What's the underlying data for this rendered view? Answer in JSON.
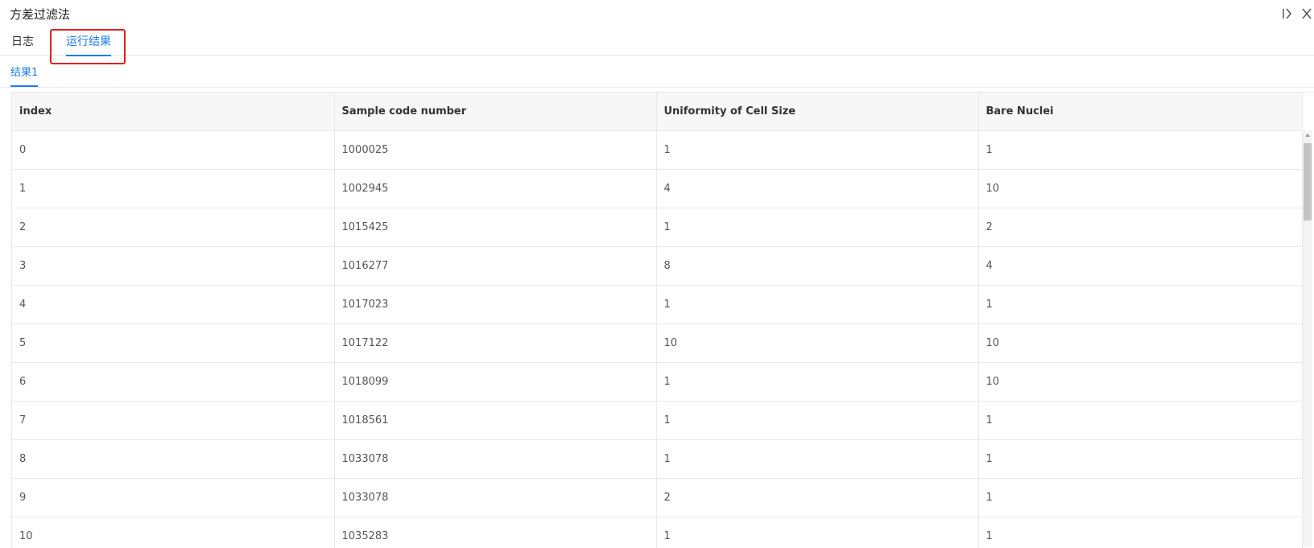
{
  "window": {
    "title": "方差过滤法",
    "controls": {
      "expand_icon": "collapse-panel-icon",
      "close_icon": "close-icon"
    }
  },
  "tabs": [
    {
      "label": "日志",
      "active": false
    },
    {
      "label": "运行结果",
      "active": true
    }
  ],
  "subtabs": [
    {
      "label": "结果1",
      "active": true
    }
  ],
  "table": {
    "columns": [
      "index",
      "Sample code number",
      "Uniformity of Cell Size",
      "Bare Nuclei"
    ],
    "rows": [
      [
        "0",
        "1000025",
        "1",
        "1"
      ],
      [
        "1",
        "1002945",
        "4",
        "10"
      ],
      [
        "2",
        "1015425",
        "1",
        "2"
      ],
      [
        "3",
        "1016277",
        "8",
        "4"
      ],
      [
        "4",
        "1017023",
        "1",
        "1"
      ],
      [
        "5",
        "1017122",
        "10",
        "10"
      ],
      [
        "6",
        "1018099",
        "1",
        "10"
      ],
      [
        "7",
        "1018561",
        "1",
        "1"
      ],
      [
        "8",
        "1033078",
        "1",
        "1"
      ],
      [
        "9",
        "1033078",
        "2",
        "1"
      ],
      [
        "10",
        "1035283",
        "1",
        "1"
      ]
    ]
  },
  "colors": {
    "accent": "#1e7cf2",
    "annotation_box": "#e02020",
    "header_bg": "#f7f7f7",
    "border": "#e8e8e8"
  }
}
